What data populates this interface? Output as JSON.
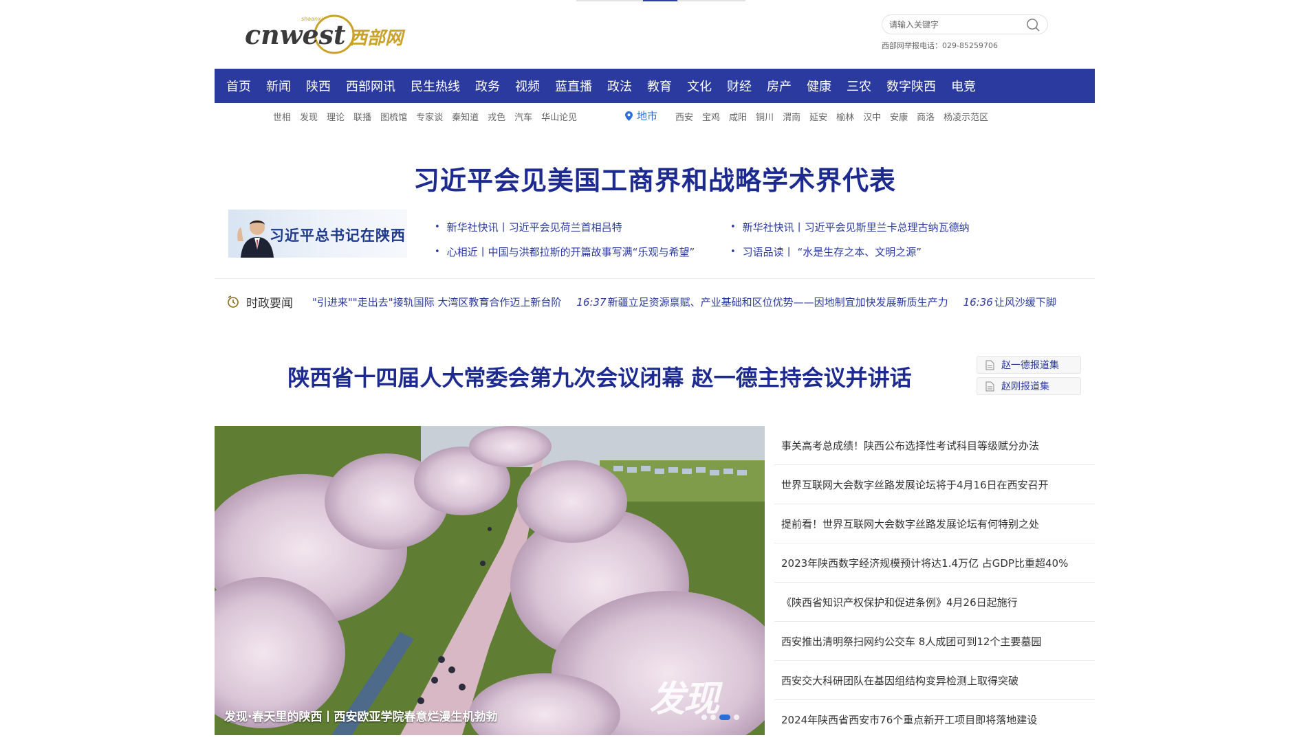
{
  "brand": {
    "logo_main": "cnwest",
    "logo_small": "shaanxi",
    "logo_cn": "西部网"
  },
  "search": {
    "placeholder": "请输入关键字",
    "icon": "search-icon"
  },
  "hotline": "西部网举报电话：029-85259706",
  "main_nav": [
    "首页",
    "新闻",
    "陕西",
    "西部网讯",
    "民生热线",
    "政务",
    "视频",
    "蓝直播",
    "政法",
    "教育",
    "文化",
    "财经",
    "房产",
    "健康",
    "三农",
    "数字陕西",
    "电竞"
  ],
  "sub_nav": {
    "topics": [
      "世相",
      "发现",
      "理论",
      "联播",
      "图梳馆",
      "专家谈",
      "秦知道",
      "戎色",
      "汽车",
      "华山论见"
    ],
    "city_label": "地市",
    "cities": [
      "西安",
      "宝鸡",
      "咸阳",
      "铜川",
      "渭南",
      "延安",
      "榆林",
      "汉中",
      "安康",
      "商洛",
      "杨凌示范区"
    ]
  },
  "headline": "习近平会见美国工商界和战略学术界代表",
  "banner": {
    "text": "习近平总书记在陕西"
  },
  "quick_links": {
    "left": [
      "新华社快讯丨习近平会见荷兰首相吕特",
      "心相近丨中国与洪都拉斯的开篇故事写满“乐观与希望”"
    ],
    "right": [
      "新华社快讯丨习近平会见斯里兰卡总理古纳瓦德纳",
      "习语品读丨 “水是生存之本、文明之源”"
    ]
  },
  "ticker": {
    "label": "时政要闻",
    "items": [
      {
        "time": "",
        "text": "\"引进来\"\"走出去\"接轨国际 大湾区教育合作迈上新台阶"
      },
      {
        "time": "16:37",
        "text": "新疆立足资源禀赋、产业基础和区位优势——因地制宜加快发展新质生产力"
      },
      {
        "time": "16:36",
        "text": "让风沙缓下脚步 为"
      }
    ]
  },
  "focus": {
    "title": "陕西省十四届人大常委会第九次会议闭幕 赵一德主持会议并讲话",
    "collections": [
      "赵一德报道集",
      "赵刚报道集"
    ]
  },
  "photo": {
    "caption": "发现·春天里的陕西丨西安欧亚学院春意烂漫生机勃勃",
    "watermark": "发现"
  },
  "news_list": [
    "事关高考总成绩！陕西公布选择性考试科目等级赋分办法",
    "世界互联网大会数字丝路发展论坛将于4月16日在西安召开",
    "提前看！世界互联网大会数字丝路发展论坛有何特别之处",
    "2023年陕西数字经济规模预计将达1.4万亿 占GDP比重超40%",
    "《陕西省知识产权保护和促进条例》4月26日起施行",
    "西安推出清明祭扫网约公交车 8人成团可到12个主要墓园",
    "西安交大科研团队在基因组结构变异检测上取得突破",
    "2024年陕西省西安市76个重点新开工项目即将落地建设"
  ],
  "colors": {
    "nav_blue": "#2b3a9f",
    "headline_blue": "#1d2a8f",
    "city_blue": "#2b6fd6"
  }
}
